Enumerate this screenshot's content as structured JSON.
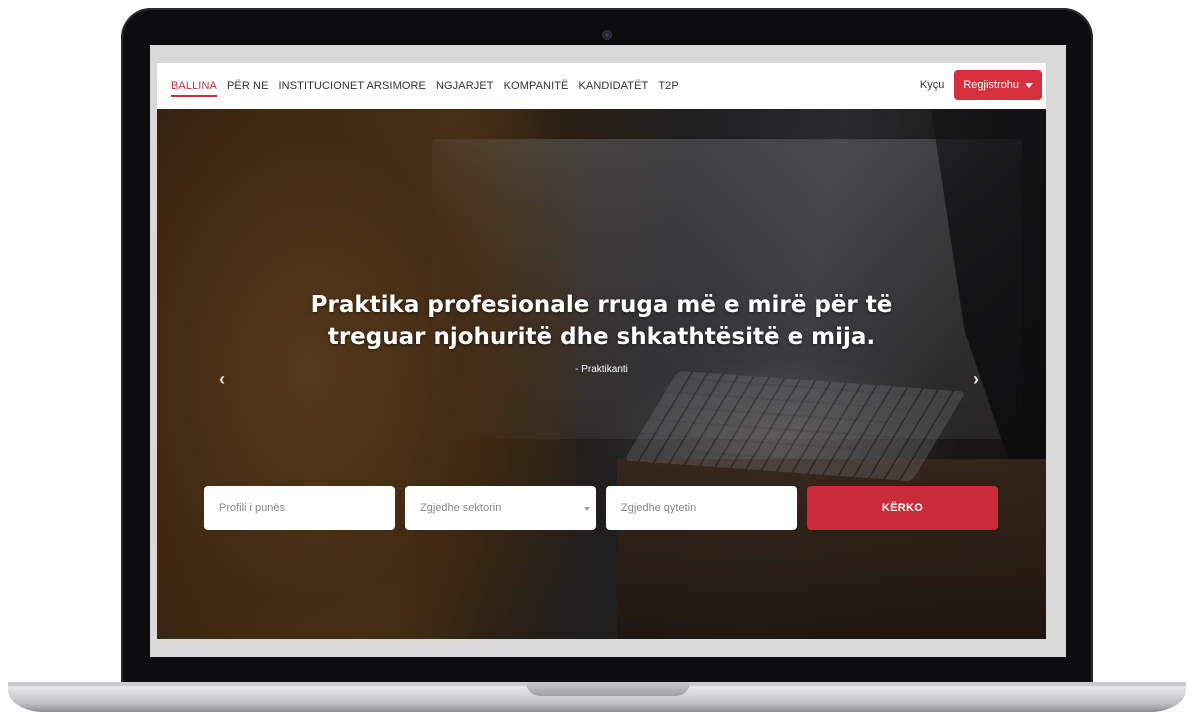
{
  "nav": {
    "links": [
      "BALLINA",
      "PËR NE",
      "INSTITUCIONET ARSIMORE",
      "NGJARJET",
      "KOMPANITË",
      "KANDIDATËT",
      "T2P"
    ],
    "login": "Kyçu",
    "register": "Regjistrohu"
  },
  "hero": {
    "quote_line1": "Praktika profesionale rruga më e mirë për të",
    "quote_line2": "treguar njohuritë dhe shkathtësitë e mija.",
    "author": "- Praktikanti",
    "prev_arrow": "‹",
    "next_arrow": "›"
  },
  "search": {
    "profile_placeholder": "Profili i punës",
    "sector_selected": "Zgjedhe sektorin",
    "city_placeholder": "Zgjedhe qytetin",
    "button": "KËRKO"
  },
  "colors": {
    "accent": "#c3323e",
    "button": "#cb2a3b"
  }
}
